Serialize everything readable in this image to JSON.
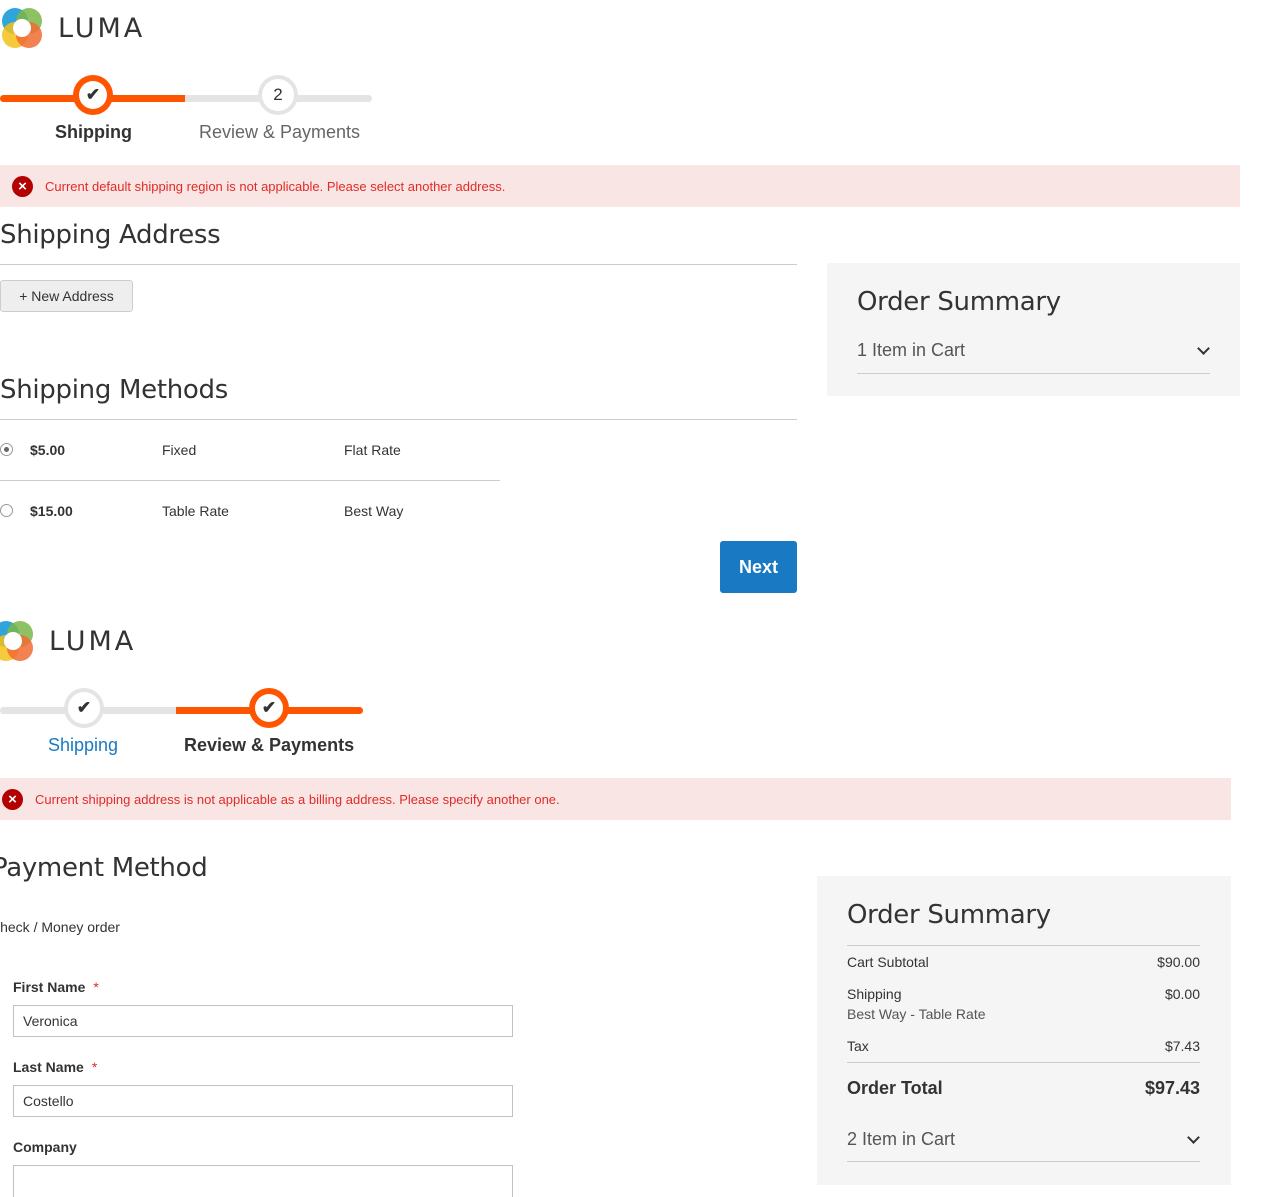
{
  "brand": {
    "name": "LUMA"
  },
  "colors": {
    "accent": "#ff5501",
    "primary_button": "#1979c3",
    "error_text": "#e02b27",
    "error_bg": "#fae5e5"
  },
  "top": {
    "progress": {
      "step1_label": "Shipping",
      "step2_label": "Review & Payments",
      "step2_number": "2"
    },
    "error_message": "Current default shipping region is not applicable. Please select another address.",
    "shipping_address_title": "Shipping Address",
    "new_address_button": "+ New Address",
    "shipping_methods_title": "Shipping Methods",
    "methods": [
      {
        "price": "$5.00",
        "method": "Fixed",
        "carrier": "Flat Rate",
        "selected": true
      },
      {
        "price": "$15.00",
        "method": "Table Rate",
        "carrier": "Best Way",
        "selected": false
      }
    ],
    "next_button": "Next",
    "summary": {
      "title": "Order Summary",
      "items_in_cart": "1 Item in Cart"
    }
  },
  "bottom": {
    "progress": {
      "step1_label": "Shipping",
      "step2_label": "Review & Payments"
    },
    "error_message": "Current shipping address is not applicable as a billing address. Please specify another one.",
    "payment_method_title": "Payment Method",
    "payment_option": "Check / Money order",
    "fields": {
      "first_name_label": "First Name",
      "first_name_value": "Veronica",
      "last_name_label": "Last Name",
      "last_name_value": "Costello",
      "company_label": "Company",
      "company_value": "",
      "required_mark": "*"
    },
    "summary": {
      "title": "Order Summary",
      "cart_subtotal_label": "Cart Subtotal",
      "cart_subtotal_value": "$90.00",
      "shipping_label": "Shipping",
      "shipping_method": "Best Way - Table Rate",
      "shipping_value": "$0.00",
      "tax_label": "Tax",
      "tax_value": "$7.43",
      "order_total_label": "Order Total",
      "order_total_value": "$97.43",
      "items_in_cart": "2 Item in Cart"
    }
  }
}
